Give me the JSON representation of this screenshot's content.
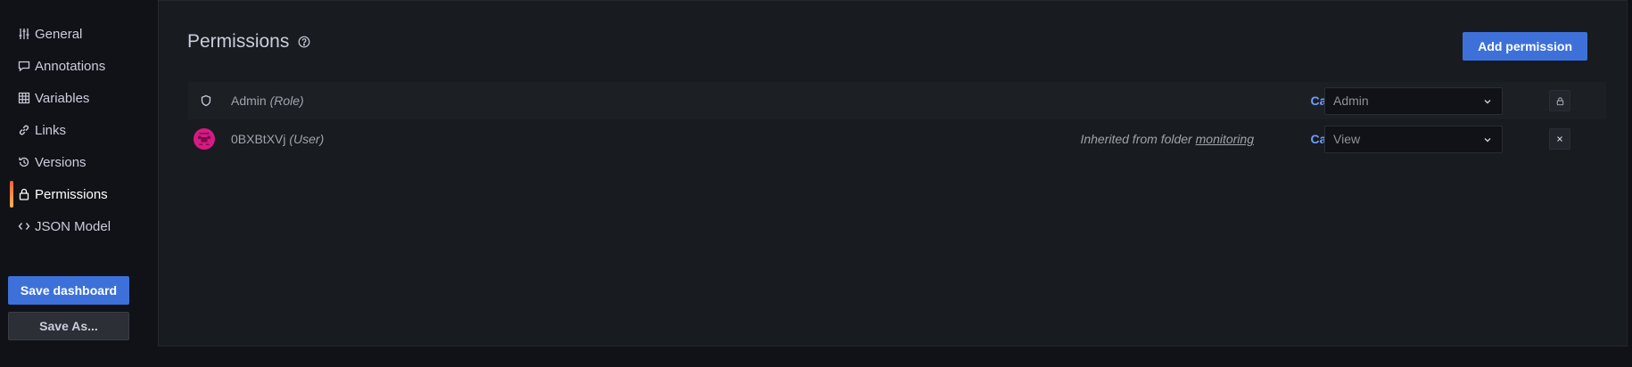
{
  "sidebar": {
    "items": [
      {
        "label": "General",
        "icon": "sliders-icon"
      },
      {
        "label": "Annotations",
        "icon": "comment-icon"
      },
      {
        "label": "Variables",
        "icon": "table-icon"
      },
      {
        "label": "Links",
        "icon": "link-icon"
      },
      {
        "label": "Versions",
        "icon": "history-icon"
      },
      {
        "label": "Permissions",
        "icon": "lock-icon",
        "active": true
      },
      {
        "label": "JSON Model",
        "icon": "code-icon"
      }
    ],
    "save_label": "Save dashboard",
    "save_as_label": "Save As..."
  },
  "main": {
    "title": "Permissions",
    "add_button": "Add permission",
    "rows": [
      {
        "name": "Admin",
        "kind": "(Role)",
        "can": "Can",
        "permission": "Admin",
        "action_icon": "lock-icon"
      },
      {
        "name": "0BXBtXVj",
        "kind": "(User)",
        "inherited_prefix": "Inherited from folder",
        "inherited_folder": "monitoring",
        "can": "Can",
        "permission": "View",
        "action_icon": "close-icon"
      }
    ]
  },
  "colors": {
    "background": "#111217",
    "panel": "#181b1f",
    "primary": "#3d71d9",
    "can_text": "#6e9fff",
    "active_indicator": "#f55f3e"
  }
}
